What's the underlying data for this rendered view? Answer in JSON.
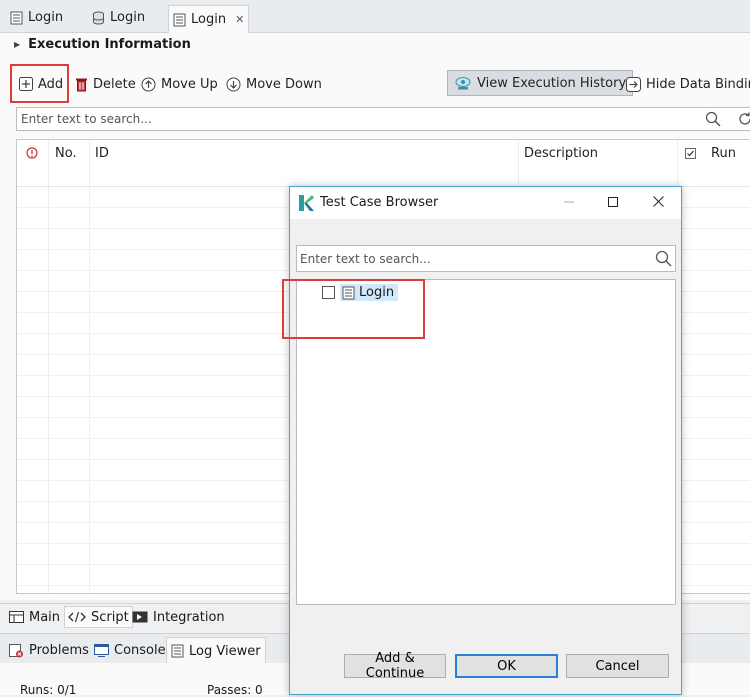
{
  "editor_tabs": [
    {
      "label": "Login",
      "icon": "test-suite-icon"
    },
    {
      "label": "Login",
      "icon": "data-file-icon"
    },
    {
      "label": "Login",
      "icon": "test-suite-icon"
    }
  ],
  "section": {
    "title": "Execution Information"
  },
  "toolbar": {
    "add": "Add",
    "delete": "Delete",
    "move_up": "Move Up",
    "move_down": "Move Down",
    "view_history": "View Execution History",
    "hide_binding": "Hide Data Binding"
  },
  "main_search": {
    "placeholder": "Enter text to search..."
  },
  "table": {
    "columns": {
      "no": "No.",
      "id": "ID",
      "description": "Description",
      "run": "Run"
    }
  },
  "bottom_tabs": [
    "Main",
    "Script",
    "Integration"
  ],
  "panel_tabs": [
    "Problems",
    "Console",
    "Log Viewer"
  ],
  "status": {
    "runs": "Runs: 0/1",
    "passes": "Passes: 0"
  },
  "dialog": {
    "title": "Test Case Browser",
    "search_placeholder": "Enter text to search...",
    "tree_item": "Login",
    "buttons": {
      "add_continue": "Add & Continue",
      "ok": "OK",
      "cancel": "Cancel"
    }
  },
  "colors": {
    "highlight": "#e03a3a",
    "accent": "#2a7fd4",
    "selection": "#cfe8fc"
  }
}
